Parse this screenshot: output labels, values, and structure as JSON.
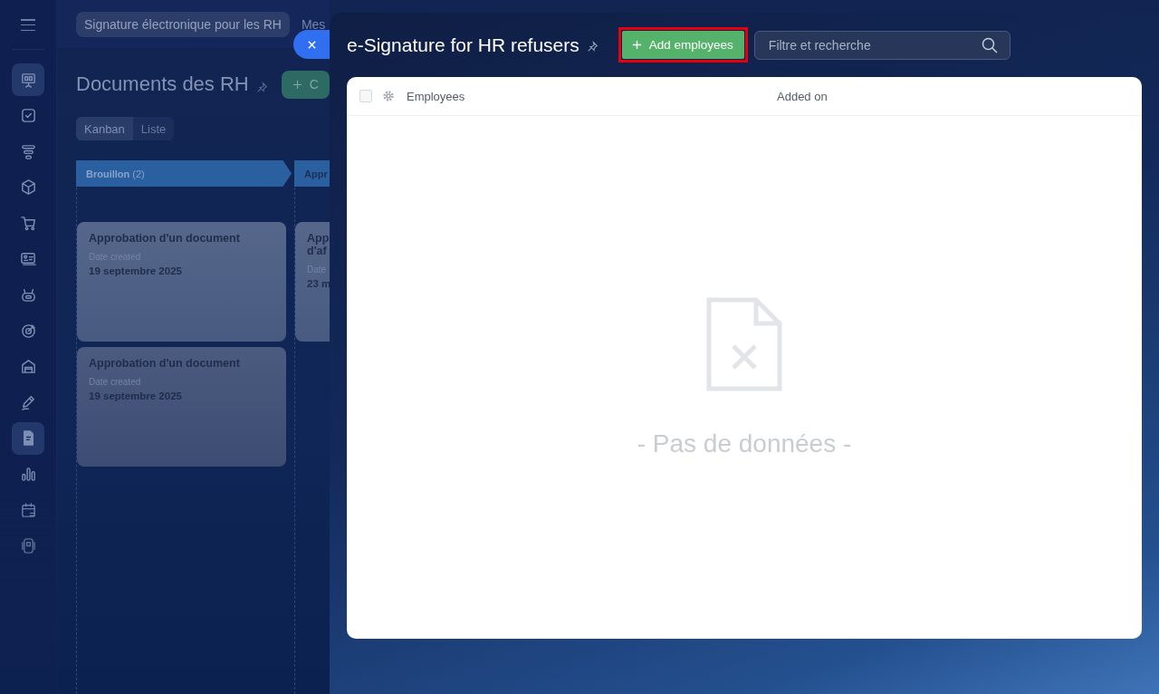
{
  "sidebar": {
    "items": [
      {
        "kind": "board",
        "selected": true
      },
      {
        "kind": "check",
        "selected": false
      },
      {
        "kind": "funnel",
        "selected": false
      },
      {
        "kind": "box",
        "selected": false
      },
      {
        "kind": "cart",
        "selected": false
      },
      {
        "kind": "card",
        "selected": false
      },
      {
        "kind": "robot",
        "selected": false
      },
      {
        "kind": "target",
        "selected": false
      },
      {
        "kind": "warehouse",
        "selected": false
      },
      {
        "kind": "pen",
        "selected": false
      },
      {
        "kind": "document",
        "selected": true
      },
      {
        "kind": "chart",
        "selected": false
      },
      {
        "kind": "calendar",
        "selected": false
      },
      {
        "kind": "phone",
        "selected": false
      }
    ]
  },
  "topbar": {
    "breadcrumb": "Signature électronique pour les RH",
    "next_tab": "Mes"
  },
  "page": {
    "title": "Documents des RH",
    "create_button": "C",
    "views": [
      {
        "label": "Kanban",
        "selected": true
      },
      {
        "label": "Liste",
        "selected": false
      }
    ]
  },
  "columns": [
    {
      "title": "Brouillon",
      "count": "(2)",
      "cards": [
        {
          "lines": [
            "Approbation d'un document"
          ],
          "date_label": "Date created",
          "date": "19 septembre 2025"
        },
        {
          "lines": [
            "Approbation d'un document"
          ],
          "date_label": "Date created",
          "date": "19 septembre 2025"
        }
      ]
    },
    {
      "title": "Appr",
      "cards": [
        {
          "lines": [
            "App",
            "d'af"
          ],
          "date_label": "Date",
          "date": "23 m"
        }
      ]
    }
  ],
  "panel": {
    "title": "e-Signature for HR refusers",
    "add_button": {
      "label": "Add employees",
      "highlighted": true
    },
    "search": {
      "placeholder": "Filtre et recherche"
    },
    "table": {
      "select_all_checked": false,
      "columns": [
        "Employees",
        "Added on"
      ],
      "empty_text": "- Pas de données -"
    }
  }
}
